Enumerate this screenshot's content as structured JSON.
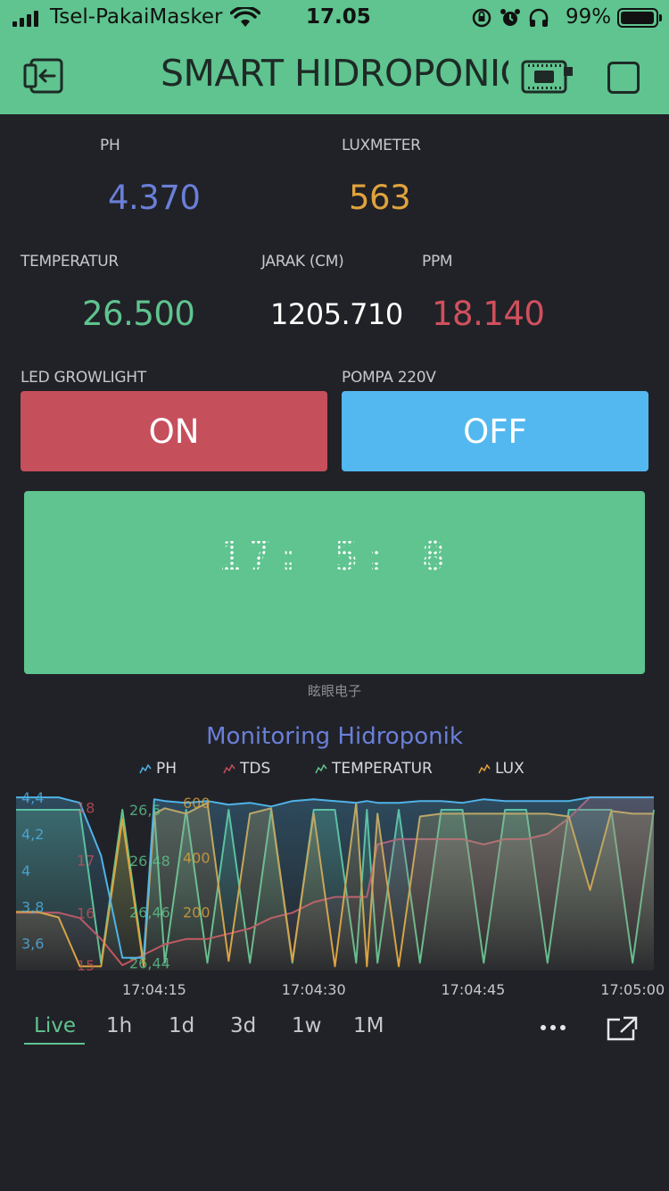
{
  "status_bar": {
    "carrier": "Tsel-PakaiMasker",
    "time": "17.05",
    "battery": "99%"
  },
  "header": {
    "title": "SMART HIDROPONIC",
    "icons": [
      "back-icon",
      "device-icon",
      "square-icon"
    ]
  },
  "displays": {
    "ph": {
      "label": "PH",
      "value": "4.370",
      "color": "#6a7fd8"
    },
    "luxmeter": {
      "label": "LUXMETER",
      "value": "563",
      "color": "#e0a33c"
    },
    "temperatur": {
      "label": "TEMPERATUR",
      "value": "26.500",
      "color": "#5fc48f"
    },
    "jarak": {
      "label": "JARAK (CM)",
      "value": "1205.710",
      "color": "#ffffff"
    },
    "ppm": {
      "label": "PPM",
      "value": "18.140",
      "color": "#d0505e"
    }
  },
  "buttons": {
    "led": {
      "label": "LED GROWLIGHT",
      "state": "ON",
      "color": "#c64f5c"
    },
    "pompa": {
      "label": "POMPA 220V",
      "state": "OFF",
      "color": "#53b8ef"
    }
  },
  "lcd": {
    "text": "17: 5: 8",
    "brand": "眩眼电子"
  },
  "chart_title": "Monitoring Hidroponik",
  "chart_data": {
    "type": "line",
    "title": "Monitoring Hidroponik",
    "legend_placement": "top",
    "x_ticks": [
      "17:04:15",
      "17:04:30",
      "17:04:45",
      "17:05:00"
    ],
    "x_range_seconds": [
      -13,
      47
    ],
    "x": [
      -13,
      -11,
      -9,
      -7,
      -5,
      -3,
      -1,
      0,
      1,
      3,
      5,
      7,
      9,
      11,
      13,
      15,
      17,
      19,
      20,
      21,
      23,
      25,
      27,
      29,
      31,
      33,
      35,
      37,
      39,
      41,
      43,
      45,
      47
    ],
    "series": [
      {
        "name": "PH",
        "color": "#4fb3e8",
        "ylim": [
          3.45,
          4.43
        ],
        "y_ticks": [
          "4,4",
          "4,2",
          "4",
          "3,8",
          "3,6"
        ],
        "y_tick_values": [
          4.4,
          4.2,
          4.0,
          3.8,
          3.6
        ],
        "values": [
          4.4,
          4.4,
          4.4,
          4.37,
          4.08,
          3.52,
          3.52,
          4.39,
          4.38,
          4.37,
          4.38,
          4.36,
          4.37,
          4.35,
          4.38,
          4.39,
          4.38,
          4.37,
          4.38,
          4.37,
          4.37,
          4.38,
          4.38,
          4.37,
          4.39,
          4.38,
          4.38,
          4.38,
          4.38,
          4.4,
          4.4,
          4.4,
          4.4
        ]
      },
      {
        "name": "TDS",
        "color": "#c64f5c",
        "ylim": [
          14.9,
          18.3
        ],
        "y_ticks": [
          "18",
          "17",
          "16",
          "15"
        ],
        "y_tick_values": [
          18,
          17,
          16,
          15
        ],
        "values": [
          16.0,
          16.0,
          16.0,
          15.9,
          15.5,
          15.0,
          15.2,
          15.3,
          15.4,
          15.5,
          15.5,
          15.6,
          15.7,
          15.9,
          16.0,
          16.2,
          16.3,
          16.3,
          16.3,
          17.3,
          17.4,
          17.4,
          17.4,
          17.4,
          17.3,
          17.4,
          17.4,
          17.5,
          17.8,
          18.2,
          18.2,
          18.2,
          18.2
        ]
      },
      {
        "name": "TEMPERATUR",
        "color": "#5fc48f",
        "ylim": [
          26.437,
          26.507
        ],
        "y_ticks": [
          "26,5",
          "26,48",
          "26,46",
          "26,44"
        ],
        "y_tick_values": [
          26.5,
          26.48,
          26.46,
          26.44
        ],
        "values": [
          26.5,
          26.5,
          26.5,
          26.5,
          26.44,
          26.5,
          26.44,
          26.5,
          26.44,
          26.5,
          26.44,
          26.5,
          26.44,
          26.5,
          26.44,
          26.5,
          26.5,
          26.44,
          26.5,
          26.44,
          26.5,
          26.44,
          26.5,
          26.5,
          26.44,
          26.5,
          26.5,
          26.44,
          26.5,
          26.5,
          26.5,
          26.44,
          26.5
        ]
      },
      {
        "name": "LUX",
        "color": "#e0a33c",
        "ylim": [
          -15,
          640
        ],
        "y_ticks": [
          "600",
          "400",
          "200"
        ],
        "y_tick_values": [
          600,
          400,
          200
        ],
        "values": [
          200,
          200,
          180,
          0,
          0,
          540,
          0,
          560,
          580,
          560,
          600,
          20,
          560,
          580,
          20,
          560,
          0,
          600,
          0,
          560,
          0,
          550,
          560,
          560,
          560,
          560,
          560,
          560,
          550,
          280,
          570,
          560,
          560
        ]
      }
    ]
  },
  "periods": [
    "Live",
    "1h",
    "1d",
    "3d",
    "1w",
    "1M"
  ],
  "active_period": "Live"
}
